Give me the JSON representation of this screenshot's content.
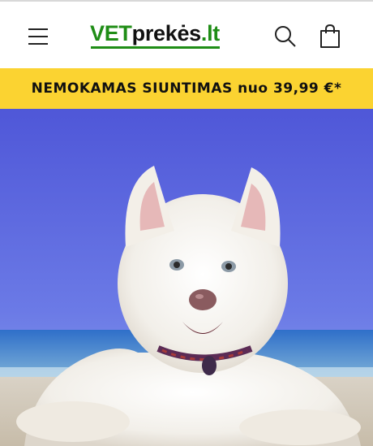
{
  "header": {
    "menu_icon": "hamburger-menu-icon",
    "logo": {
      "part1": "VET",
      "part2": "prekės",
      "part3": ".lt"
    },
    "search_icon": "search-icon",
    "cart_icon": "shopping-bag-icon"
  },
  "announcement": {
    "text": "NEMOKAMAS SIUNTIMAS nuo 39,99 €*",
    "background": "#fbd331"
  },
  "hero": {
    "image": "white-puppy-on-beach"
  },
  "colors": {
    "brand_green": "#1f8d16",
    "announcement_yellow": "#fbd331",
    "sky_blue": "#5a63dc"
  }
}
